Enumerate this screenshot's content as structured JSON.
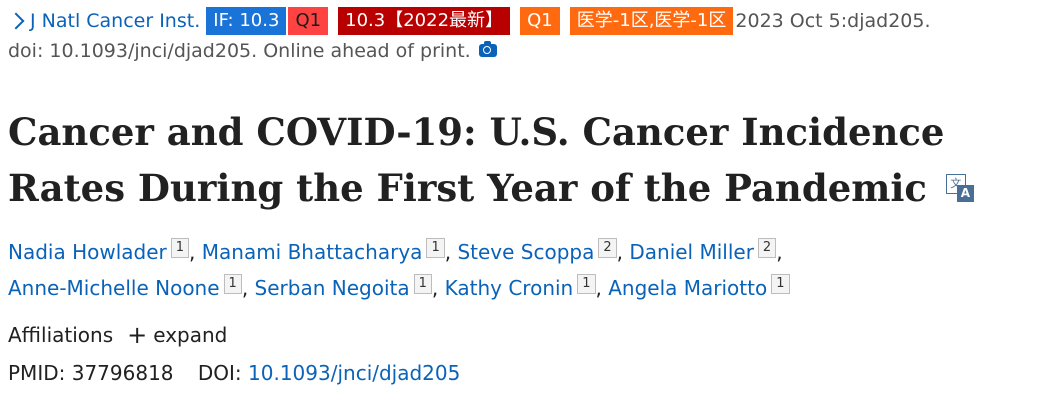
{
  "citation": {
    "journal_link": "J Natl Cancer Inst.",
    "badges": {
      "impact_factor": "IF: 10.3",
      "quartile_jcr": "Q1",
      "cas_score": "10.3【2022最新】",
      "quartile_cas": "Q1",
      "zone": "医学-1区,医学-1区"
    },
    "date_location": "2023 Oct 5:djad205.",
    "doi_line": "doi: 10.1093/jnci/djad205. Online ahead of print.",
    "icons": {
      "journal_chevron": "chevron-right-icon",
      "snapshot": "camera-icon"
    }
  },
  "article": {
    "title": "Cancer and COVID-19: U.S. Cancer Incidence Rates During the First Year of the Pandemic",
    "translate_icon": "translate-icon",
    "translate_glyph_front": "文",
    "translate_glyph_back": "A"
  },
  "authors": [
    {
      "name": "Nadia Howlader",
      "aff": "1"
    },
    {
      "name": "Manami Bhattacharya",
      "aff": "1"
    },
    {
      "name": "Steve Scoppa",
      "aff": "2"
    },
    {
      "name": "Daniel Miller",
      "aff": "2"
    },
    {
      "name": "Anne-Michelle Noone",
      "aff": "1"
    },
    {
      "name": "Serban Negoita",
      "aff": "1"
    },
    {
      "name": "Kathy Cronin",
      "aff": "1"
    },
    {
      "name": "Angela Mariotto",
      "aff": "1"
    }
  ],
  "affiliations": {
    "label": "Affiliations",
    "expand_label": "expand",
    "expand_icon": "plus-icon"
  },
  "identifiers": {
    "pmid_label": "PMID:",
    "pmid_value": "37796818",
    "doi_label": "DOI:",
    "doi_value": "10.1093/jnci/djad205"
  },
  "colors": {
    "link": "#0a63b8",
    "if_badge": "#1a73d6",
    "q1_jcr_badge": "#ff4343",
    "cas_badge": "#b80000",
    "orange_badge": "#ff6a10"
  }
}
